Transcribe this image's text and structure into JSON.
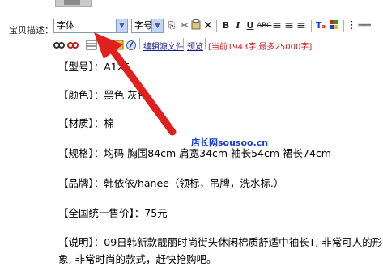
{
  "form": {
    "description_label": "宝贝描述："
  },
  "toolbar": {
    "font_family": "字体",
    "font_size": "字号",
    "items": [
      {
        "name": "copy-icon",
        "glyph": "⎘"
      },
      {
        "name": "cut-icon",
        "glyph": "✂"
      },
      {
        "name": "paste-icon",
        "glyph": "📋"
      },
      {
        "name": "delete-icon",
        "glyph": "✕"
      }
    ],
    "bold": "B",
    "italic": "I",
    "underline": "U",
    "strike": "ABC",
    "align_left": "≡",
    "align_center": "≡",
    "align_right": "≡",
    "text_color": "T",
    "bg_color": "T",
    "list": "⋮≡"
  },
  "toolbar2": {
    "edit_source": "编辑源文件",
    "preview": "预览",
    "char_count": "[当前1943字,最多25000字]"
  },
  "content": {
    "lines": [
      "【型号】：A125",
      "【颜色】：黑色 灰色",
      "【材质】：棉",
      "【规格】：均码  胸围84cm 肩宽34cm 袖长54cm 裙长74cm",
      "【品牌】：韩依依/hanee（领标，吊牌，洗水标.）",
      "【全国统一售价】：75元",
      "【说明】：09日韩新款靓丽时尚街头休闲棉质舒适中袖长T, 非常可人的形",
      "象, 非常时尚的款式，赶快抢购吧。"
    ]
  },
  "watermark": "店长网sousoo.cn",
  "annotation": {
    "arrow_color": "#e0201c"
  }
}
